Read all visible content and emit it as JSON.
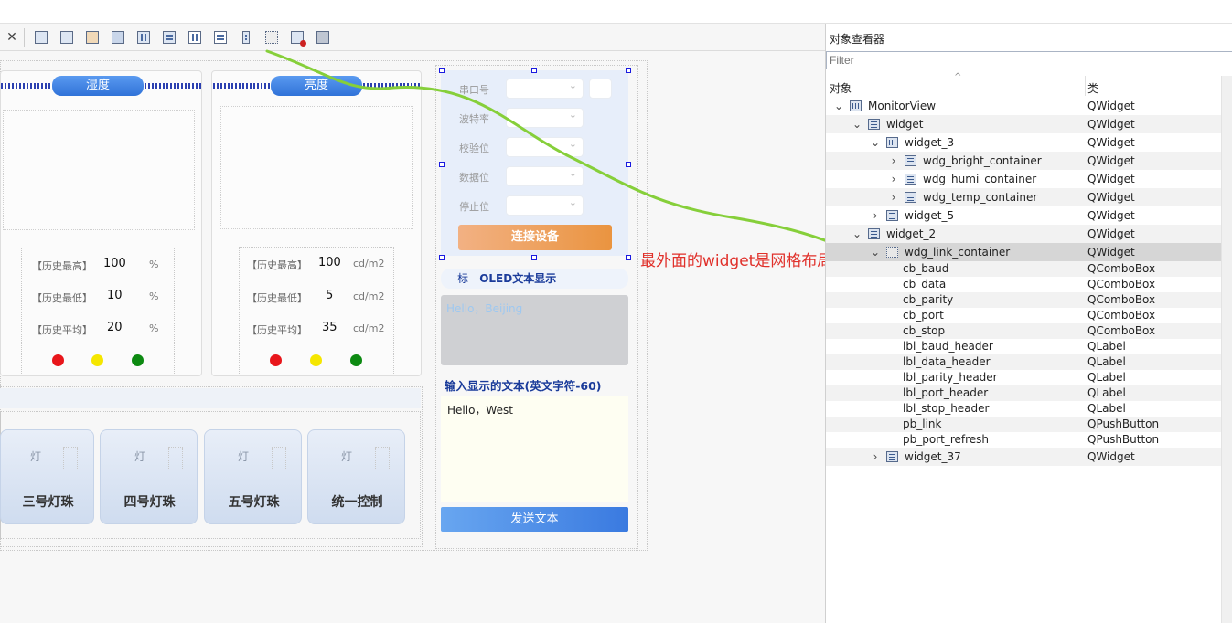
{
  "toolbar": {
    "close_glyph": "✕",
    "icons": [
      "widget-box-icon",
      "send-back-icon",
      "bring-front-icon",
      "tab-order-icon",
      "layout-horizontal-icon",
      "layout-vertical-icon",
      "horizontal-splitter-icon",
      "vertical-splitter-icon",
      "form-layout-icon",
      "grid-layout-icon",
      "break-layout-icon",
      "adjust-size-icon"
    ]
  },
  "humidity": {
    "title": "湿度",
    "rows": [
      {
        "label": "【历史最高】",
        "value": "100",
        "unit": "%"
      },
      {
        "label": "【历史最低】",
        "value": "10",
        "unit": "%"
      },
      {
        "label": "【历史平均】",
        "value": "20",
        "unit": "%"
      }
    ]
  },
  "brightness": {
    "title": "亮度",
    "rows": [
      {
        "label": "【历史最高】",
        "value": "100",
        "unit": "cd/m2"
      },
      {
        "label": "【历史最低】",
        "value": "5",
        "unit": "cd/m2"
      },
      {
        "label": "【历史平均】",
        "value": "35",
        "unit": "cd/m2"
      }
    ]
  },
  "leds": {
    "colors": [
      "#e8161b",
      "#f5e600",
      "#0d8a12"
    ]
  },
  "lamps": [
    {
      "bulb": "灯",
      "name": "三号灯珠"
    },
    {
      "bulb": "灯",
      "name": "四号灯珠"
    },
    {
      "bulb": "灯",
      "name": "五号灯珠"
    },
    {
      "bulb": "灯",
      "name": "统一控制"
    }
  ],
  "serial": {
    "port_label": "串口号",
    "baud_label": "波特率",
    "parity_label": "校验位",
    "data_label": "数据位",
    "stop_label": "停止位",
    "connect_label": "连接设备"
  },
  "oled": {
    "icon_char": "标",
    "header": "OLED文本显示",
    "display_text": "Hello，Beijing",
    "input_label": "输入显示的文本(英文字符-60)",
    "input_value": "Hello，West",
    "send_label": "发送文本"
  },
  "annotation": "最外面的widget是网格布局",
  "inspector": {
    "title": "对象查看器",
    "filter_placeholder": "Filter",
    "col_object": "对象",
    "col_class": "类",
    "rows": [
      {
        "name": "MonitorView",
        "cls": "QWidget",
        "depth": 0,
        "chev": "⌄",
        "icon": "vl"
      },
      {
        "name": "widget",
        "cls": "QWidget",
        "depth": 1,
        "chev": "⌄",
        "icon": "hl"
      },
      {
        "name": "widget_3",
        "cls": "QWidget",
        "depth": 2,
        "chev": "⌄",
        "icon": "vl"
      },
      {
        "name": "wdg_bright_container",
        "cls": "QWidget",
        "depth": 3,
        "chev": "›",
        "icon": "hl"
      },
      {
        "name": "wdg_humi_container",
        "cls": "QWidget",
        "depth": 3,
        "chev": "›",
        "icon": "hl"
      },
      {
        "name": "wdg_temp_container",
        "cls": "QWidget",
        "depth": 3,
        "chev": "›",
        "icon": "hl"
      },
      {
        "name": "widget_5",
        "cls": "QWidget",
        "depth": 2,
        "chev": "›",
        "icon": "hl"
      },
      {
        "name": "widget_2",
        "cls": "QWidget",
        "depth": 1,
        "chev": "⌄",
        "icon": "hl"
      },
      {
        "name": "wdg_link_container",
        "cls": "QWidget",
        "depth": 2,
        "chev": "⌄",
        "icon": "gl",
        "selected": true
      },
      {
        "name": "cb_baud",
        "cls": "QComboBox",
        "depth": 3
      },
      {
        "name": "cb_data",
        "cls": "QComboBox",
        "depth": 3
      },
      {
        "name": "cb_parity",
        "cls": "QComboBox",
        "depth": 3
      },
      {
        "name": "cb_port",
        "cls": "QComboBox",
        "depth": 3
      },
      {
        "name": "cb_stop",
        "cls": "QComboBox",
        "depth": 3
      },
      {
        "name": "lbl_baud_header",
        "cls": "QLabel",
        "depth": 3
      },
      {
        "name": "lbl_data_header",
        "cls": "QLabel",
        "depth": 3
      },
      {
        "name": "lbl_parity_header",
        "cls": "QLabel",
        "depth": 3
      },
      {
        "name": "lbl_port_header",
        "cls": "QLabel",
        "depth": 3
      },
      {
        "name": "lbl_stop_header",
        "cls": "QLabel",
        "depth": 3
      },
      {
        "name": "pb_link",
        "cls": "QPushButton",
        "depth": 3
      },
      {
        "name": "pb_port_refresh",
        "cls": "QPushButton",
        "depth": 3
      },
      {
        "name": "widget_37",
        "cls": "QWidget",
        "depth": 2,
        "chev": "›",
        "icon": "hl"
      }
    ]
  }
}
